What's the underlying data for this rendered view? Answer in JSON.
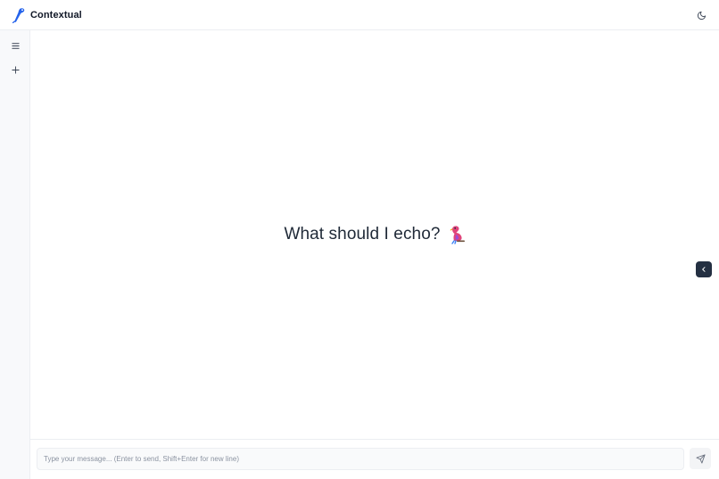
{
  "app": {
    "name": "Contextual",
    "logo_icon": "brand-logo-icon"
  },
  "header": {
    "theme_toggle_icon": "moon-icon"
  },
  "sidebar": {
    "items": [
      {
        "icon": "menu-icon"
      },
      {
        "icon": "plus-icon"
      }
    ]
  },
  "main": {
    "welcome_text": "What should I echo?",
    "welcome_icon": "parrot-icon",
    "panel_toggle_icon": "chevron-left-icon"
  },
  "composer": {
    "value": "",
    "placeholder": "Type your message... (Enter to send, Shift+Enter for new line)",
    "send_icon": "send-icon"
  },
  "colors": {
    "brand_blue": "#2563eb",
    "toggle_bg": "#243042",
    "text": "#1f2937"
  }
}
